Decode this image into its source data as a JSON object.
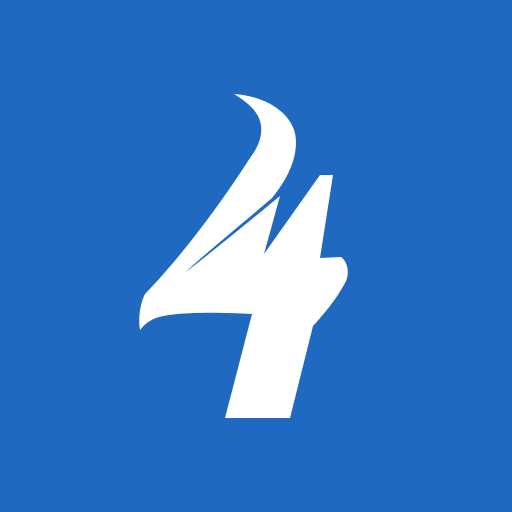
{
  "logo": {
    "text": "4",
    "icon": "numeral-four-logo-icon",
    "background_color": "#1F69C1",
    "glyph_color": "#FFFFFF"
  }
}
